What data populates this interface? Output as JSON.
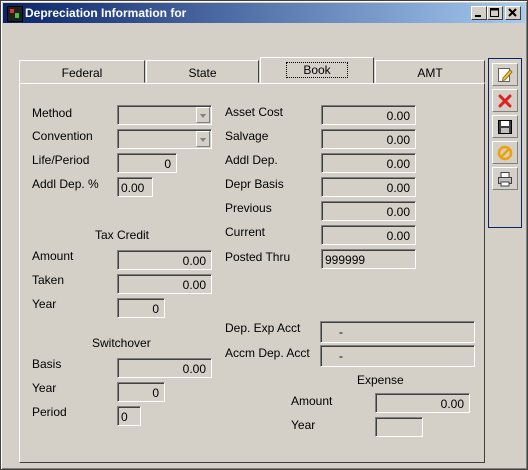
{
  "window": {
    "title": "Depreciation Information for"
  },
  "tabs": [
    {
      "label": "Federal"
    },
    {
      "label": "State"
    },
    {
      "label": "Book"
    },
    {
      "label": "AMT"
    }
  ],
  "left": {
    "method_label": "Method",
    "convention_label": "Convention",
    "life_period_label": "Life/Period",
    "life_period_value": "0",
    "addl_dep_pct_label": "Addl Dep. %",
    "addl_dep_pct_value": "0.00",
    "tax_credit_heading": "Tax Credit",
    "tc_amount_label": "Amount",
    "tc_amount_value": "0.00",
    "tc_taken_label": "Taken",
    "tc_taken_value": "0.00",
    "tc_year_label": "Year",
    "tc_year_value": "0",
    "switchover_heading": "Switchover",
    "sw_basis_label": "Basis",
    "sw_basis_value": "0.00",
    "sw_year_label": "Year",
    "sw_year_value": "0",
    "sw_period_label": "Period",
    "sw_period_value": "0"
  },
  "right": {
    "asset_cost_label": "Asset Cost",
    "asset_cost_value": "0.00",
    "salvage_label": "Salvage",
    "salvage_value": "0.00",
    "addl_dep_label": "Addl Dep.",
    "addl_dep_value": "0.00",
    "depr_basis_label": "Depr Basis",
    "depr_basis_value": "0.00",
    "previous_label": "Previous",
    "previous_value": "0.00",
    "current_label": "Current",
    "current_value": "0.00",
    "posted_thru_label": "Posted Thru",
    "posted_thru_value": "999999",
    "dep_exp_acct_label": "Dep. Exp Acct",
    "dep_exp_acct_value": "-",
    "accm_dep_acct_label": "Accm Dep. Acct",
    "accm_dep_acct_value": "-",
    "expense_heading": "Expense",
    "exp_amount_label": "Amount",
    "exp_amount_value": "0.00",
    "exp_year_label": "Year",
    "exp_year_value": ""
  },
  "toolbar": {
    "icons": [
      "edit-icon",
      "delete-icon",
      "save-icon",
      "cancel-icon",
      "print-icon"
    ]
  },
  "colors": {
    "title_start": "#0a246a",
    "title_end": "#a6caf0",
    "face": "#d4d0c8",
    "delete_red": "#e02020",
    "cancel_orange": "#f0a000"
  }
}
